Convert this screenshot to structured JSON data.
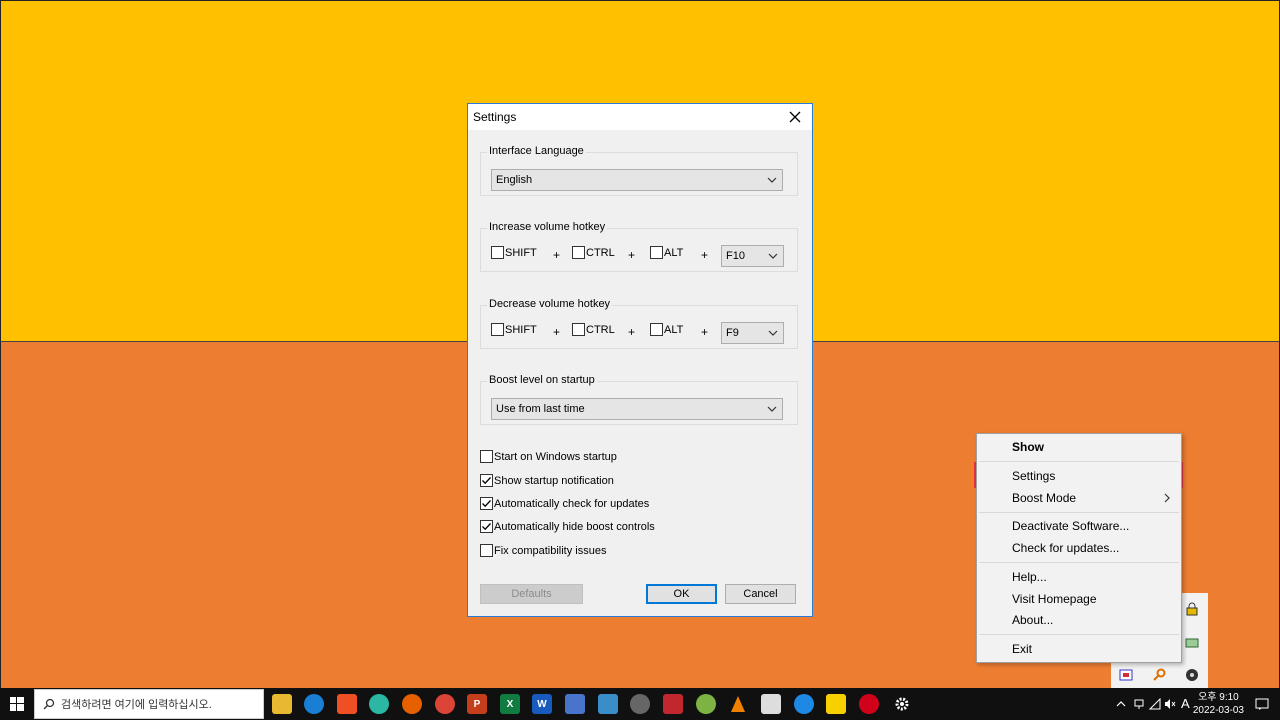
{
  "dialog": {
    "title": "Settings",
    "interface_language": {
      "legend": "Interface Language",
      "value": "English"
    },
    "increase_hotkey": {
      "legend": "Increase volume hotkey",
      "shift": "SHIFT",
      "ctrl": "CTRL",
      "alt": "ALT",
      "plus": "+",
      "key": "F10"
    },
    "decrease_hotkey": {
      "legend": "Decrease volume hotkey",
      "shift": "SHIFT",
      "ctrl": "CTRL",
      "alt": "ALT",
      "plus": "+",
      "key": "F9"
    },
    "boost_startup": {
      "legend": "Boost level on startup",
      "value": "Use from last time"
    },
    "options": [
      {
        "label": "Start on Windows startup",
        "checked": false
      },
      {
        "label": "Show startup notification",
        "checked": true
      },
      {
        "label": "Automatically check for updates",
        "checked": true
      },
      {
        "label": "Automatically hide boost controls",
        "checked": true
      },
      {
        "label": "Fix compatibility issues",
        "checked": false
      }
    ],
    "buttons": {
      "defaults": "Defaults",
      "ok": "OK",
      "cancel": "Cancel"
    }
  },
  "context_menu": {
    "show": "Show",
    "settings": "Settings",
    "boost_mode": "Boost Mode",
    "deactivate": "Deactivate Software...",
    "check_updates": "Check for updates...",
    "help": "Help...",
    "homepage": "Visit Homepage",
    "about": "About...",
    "exit": "Exit"
  },
  "taskbar": {
    "search_placeholder": "검색하려면 여기에 입력하십시오.",
    "time": "오후 9:10",
    "date": "2022-03-03",
    "ime": "A"
  }
}
